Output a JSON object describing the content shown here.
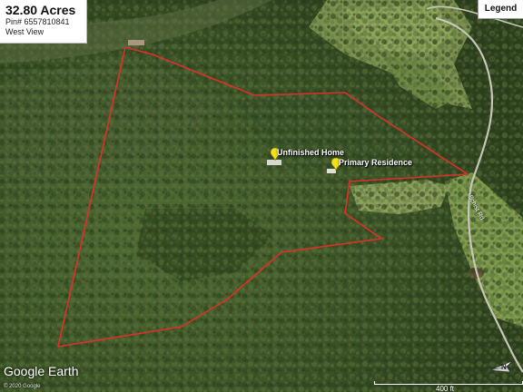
{
  "info": {
    "acreage": "32.80 Acres",
    "pin": "Pin# 6557810841",
    "view": "West View"
  },
  "legend_label": "Legend",
  "markers": [
    {
      "label": "Unfinished Home"
    },
    {
      "label": "Primary Residence"
    }
  ],
  "road_label": "Schist Rd",
  "branding": "Google Earth",
  "copyright": "© 2020 Google",
  "scale": "400 ft",
  "colors": {
    "boundary": "#e0302a",
    "pin": "#f4e01a"
  }
}
